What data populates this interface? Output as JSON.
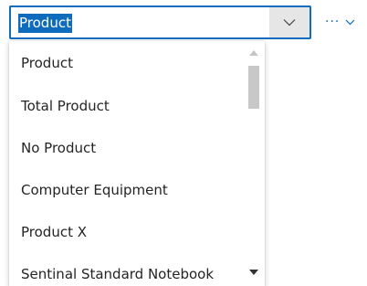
{
  "combo": {
    "value": "Product",
    "dropdown_icon": "chevron-down-icon"
  },
  "more": {
    "icon": "more-icon",
    "chevron_icon": "chevron-down-icon",
    "color": "#0f6cbd"
  },
  "accent_color": "#0f6cbd",
  "options": [
    "Product",
    "Total Product",
    "No Product",
    "Computer Equipment",
    "Product X",
    "Sentinal Standard Notebook"
  ],
  "scrollbar": {
    "up_icon": "scroll-up-arrow-icon",
    "down_icon": "scroll-down-arrow-icon",
    "position_fraction": 0.0
  }
}
